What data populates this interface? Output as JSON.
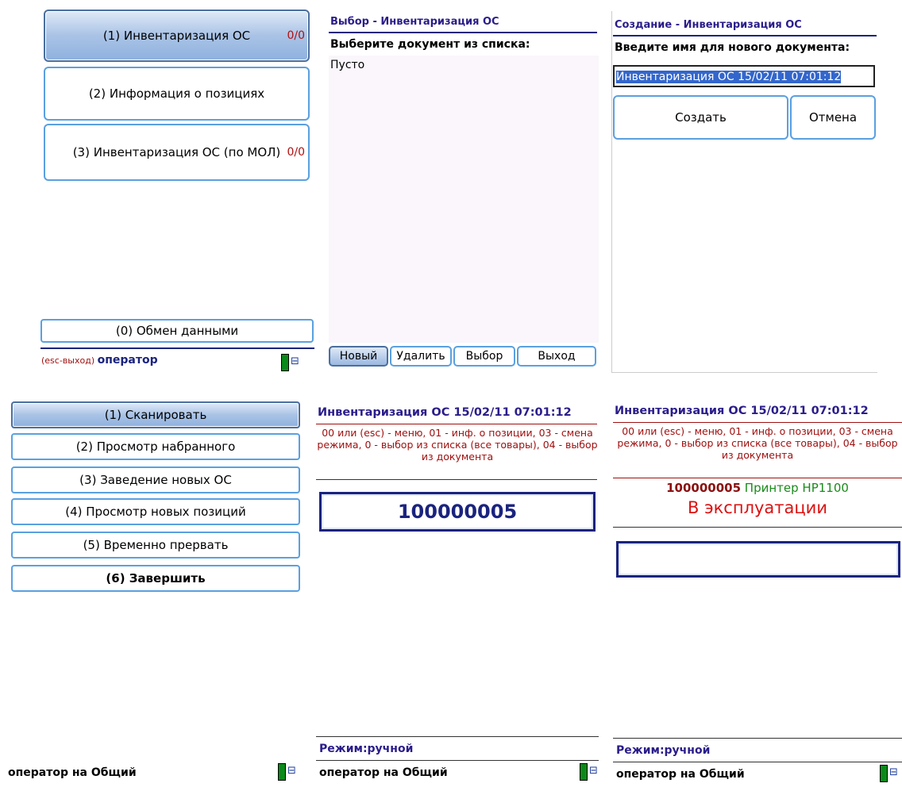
{
  "panel1": {
    "menu": [
      {
        "label": "(1) Инвентаризация ОС",
        "count": "0/0"
      },
      {
        "label": "(2) Информация о позициях",
        "count": ""
      },
      {
        "label": "(3) Инвентаризация ОС (по МОЛ)",
        "count": "0/0"
      }
    ],
    "exchange_label": "(0) Обмен данными",
    "status_hint": "(esc-выход)",
    "status_user": "оператор"
  },
  "panel2": {
    "title": "Выбор - Инвентаризация ОС",
    "prompt": "Выберите документ из списка:",
    "empty_text": "Пусто",
    "buttons": [
      "Новый",
      "Удалить",
      "Выбор",
      "Выход"
    ]
  },
  "panel3": {
    "title": "Создание - Инвентаризация ОС",
    "prompt": "Введите имя для нового документа:",
    "input_value": "Инвентаризация ОС 15/02/11 07:01:12",
    "create_label": "Создать",
    "cancel_label": "Отмена"
  },
  "panel4": {
    "menu": [
      "(1) Сканировать",
      "(2) Просмотр набранного",
      "(3) Заведение новых ОС",
      "(4) Просмотр новых позиций",
      "(5) Временно прервать",
      "(6) Завершить"
    ],
    "status": "оператор на Общий"
  },
  "panel5": {
    "title": "Инвентаризация ОС 15/02/11 07:01:12",
    "help": "00 или (esc) - меню, 01 - инф. о позиции, 03 - смена режима, 0 - выбор из списка (все товары), 04 - выбор из документа",
    "scan_value": "100000005",
    "mode": "Режим:ручной",
    "status": "оператор на Общий"
  },
  "panel6": {
    "title": "Инвентаризация ОС 15/02/11 07:01:12",
    "help": "00 или (esc) - меню, 01 - инф. о позиции, 03 - смена режима, 0 - выбор из списка (все товары), 04 - выбор из документа",
    "item_code": "100000005",
    "item_name": "Принтер HP1100",
    "item_state": "В эксплуатации",
    "scan_value": "",
    "mode": "Режим:ручной",
    "status": "оператор на Общий"
  }
}
